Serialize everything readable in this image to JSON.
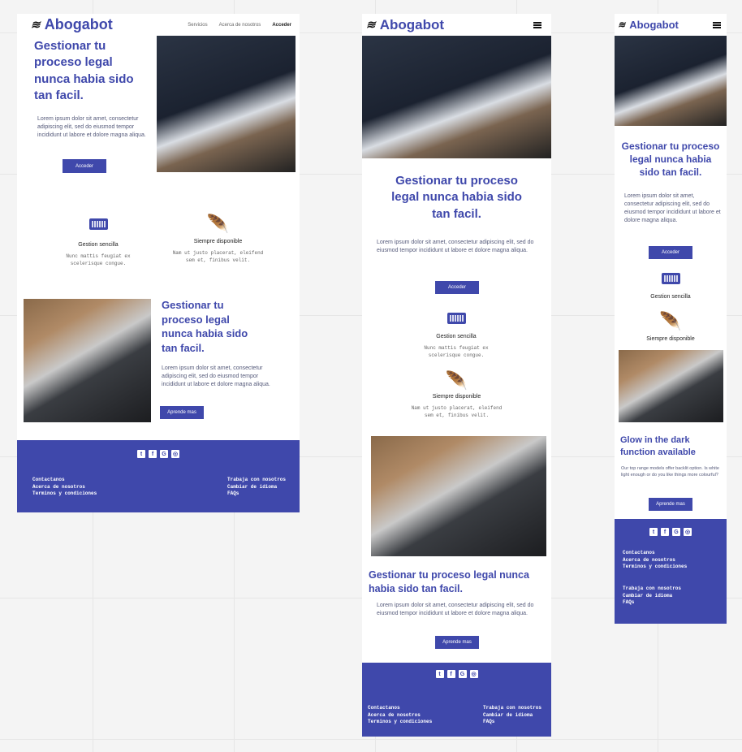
{
  "brand": "Abogabot",
  "nav": {
    "services": "Servicios",
    "about": "Acerca de nosotros",
    "login": "Acceder"
  },
  "hero": {
    "title": "Gestionar tu proceso legal nunca habia sido tan facil.",
    "body": "Lorem ipsum dolor sit amet, consectetur adipiscing elit, sed do eiusmod tempor incididunt ut labore et dolore magna aliqua.",
    "button": "Acceder"
  },
  "features": [
    {
      "icon": "keyboard-icon",
      "title": "Gestion sencilla",
      "desc": "Nunc mattis feugiat ex scelerisque congue."
    },
    {
      "icon": "feather-icon",
      "title": "Siempre disponible",
      "desc": "Nam ut justo placerat, eleifend sem et, finibus velit."
    }
  ],
  "section2": {
    "title": "Gestionar tu proceso legal nunca habia sido tan facil.",
    "body": "Lorem ipsum dolor sit amet, consectetur adipiscing elit, sed do eiusmod tempor incididunt ut labore et dolore magna aliqua.",
    "button": "Aprende mas"
  },
  "mobile_section2": {
    "title": "Glow in the dark function available",
    "body": "Our top range models offer backlit option. Is white light enough or do you like things more colourful?",
    "button": "Aprende mas"
  },
  "footer": {
    "socials": [
      "twitter-icon",
      "facebook-icon",
      "google-plus-icon",
      "instagram-icon"
    ],
    "col1": [
      "Contactanos",
      "Acerca de nosotros",
      "Terminos y condiciones"
    ],
    "col2": [
      "Trabaja con nosotros",
      "Cambiar de idioma",
      "FAQs"
    ]
  },
  "colors": {
    "accent": "#3f48ab"
  }
}
